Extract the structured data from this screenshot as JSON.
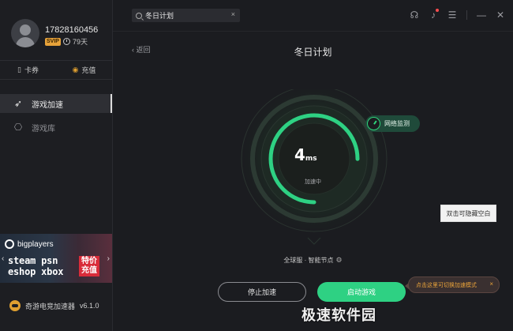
{
  "user": {
    "phone": "17828160456",
    "vip_badge": "SVIP",
    "days_left": "79天"
  },
  "account_bar": {
    "coupon_label": "卡券",
    "recharge_label": "充值"
  },
  "nav": {
    "items": [
      {
        "label": "游戏加速"
      },
      {
        "label": "游戏库"
      }
    ]
  },
  "banner": {
    "brand": "bigplayers",
    "line1": "steam psn",
    "line2": "eshop xbox",
    "tag": "特价充值"
  },
  "app": {
    "name": "奇游电竞加速器",
    "version": "v6.1.0"
  },
  "search": {
    "value": "冬日计划",
    "clear": "×"
  },
  "header": {
    "back_label": "返回",
    "title": "冬日计划"
  },
  "gauge": {
    "latency_value": "4",
    "latency_unit": "ms",
    "status": "加速中",
    "progress": 0.75
  },
  "net_monitor": {
    "label": "网络监测"
  },
  "node": {
    "label": "全球服 · 智能节点"
  },
  "buttons": {
    "stop": "停止加速",
    "start": "启动游戏"
  },
  "tooltip": {
    "text": "双击可隐藏空白"
  },
  "toast": {
    "text": "点击这里可切换加速模式",
    "close": "×"
  },
  "watermark": {
    "text": "极速软件园"
  },
  "colors": {
    "accent": "#2ed183",
    "vip": "#e6a23a",
    "background": "#1b1c20",
    "sidebar": "#1d1e22"
  }
}
